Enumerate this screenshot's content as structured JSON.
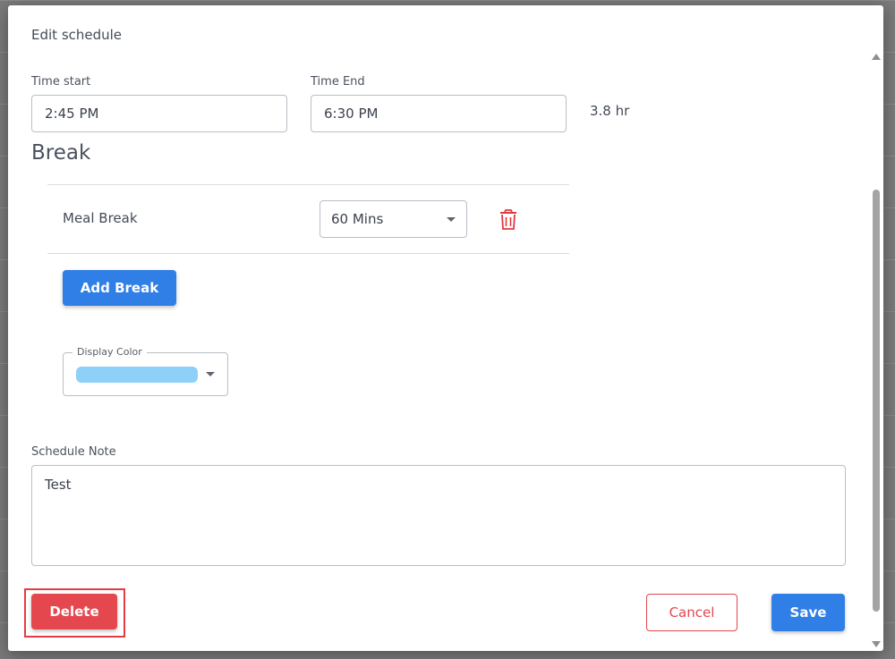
{
  "modal": {
    "title": "Edit schedule"
  },
  "time": {
    "start_label": "Time start",
    "start_value": "2:45 PM",
    "end_label": "Time End",
    "end_value": "6:30 PM",
    "duration": "3.8 hr"
  },
  "break": {
    "heading": "Break",
    "items": [
      {
        "name": "Meal Break",
        "duration": "60 Mins"
      }
    ],
    "add_label": "Add Break"
  },
  "display_color": {
    "label": "Display Color",
    "value_color": "#8ed0f8"
  },
  "note": {
    "label": "Schedule Note",
    "value": "Test"
  },
  "actions": {
    "delete_label": "Delete",
    "cancel_label": "Cancel",
    "save_label": "Save"
  },
  "colors": {
    "primary": "#2f7fe6",
    "danger": "#e5474e"
  }
}
